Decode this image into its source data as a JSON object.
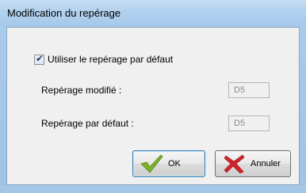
{
  "window": {
    "title": "Modification du repérage"
  },
  "options": {
    "use_default_checkbox": {
      "label": "Utiliser le repérage par défaut",
      "checked": true
    }
  },
  "fields": {
    "modified": {
      "label": "Repérage modifié :",
      "value": "D5"
    },
    "default": {
      "label": "Repérage par défaut :",
      "value": "D5"
    }
  },
  "buttons": {
    "ok_label": "OK",
    "cancel_label": "Annuler"
  },
  "icons": {
    "ok": "checkmark-icon",
    "cancel": "x-icon"
  },
  "colors": {
    "title_bar": "#b1d1ee",
    "checkmark": "#7ab02a",
    "cancel_x": "#d2232a"
  }
}
